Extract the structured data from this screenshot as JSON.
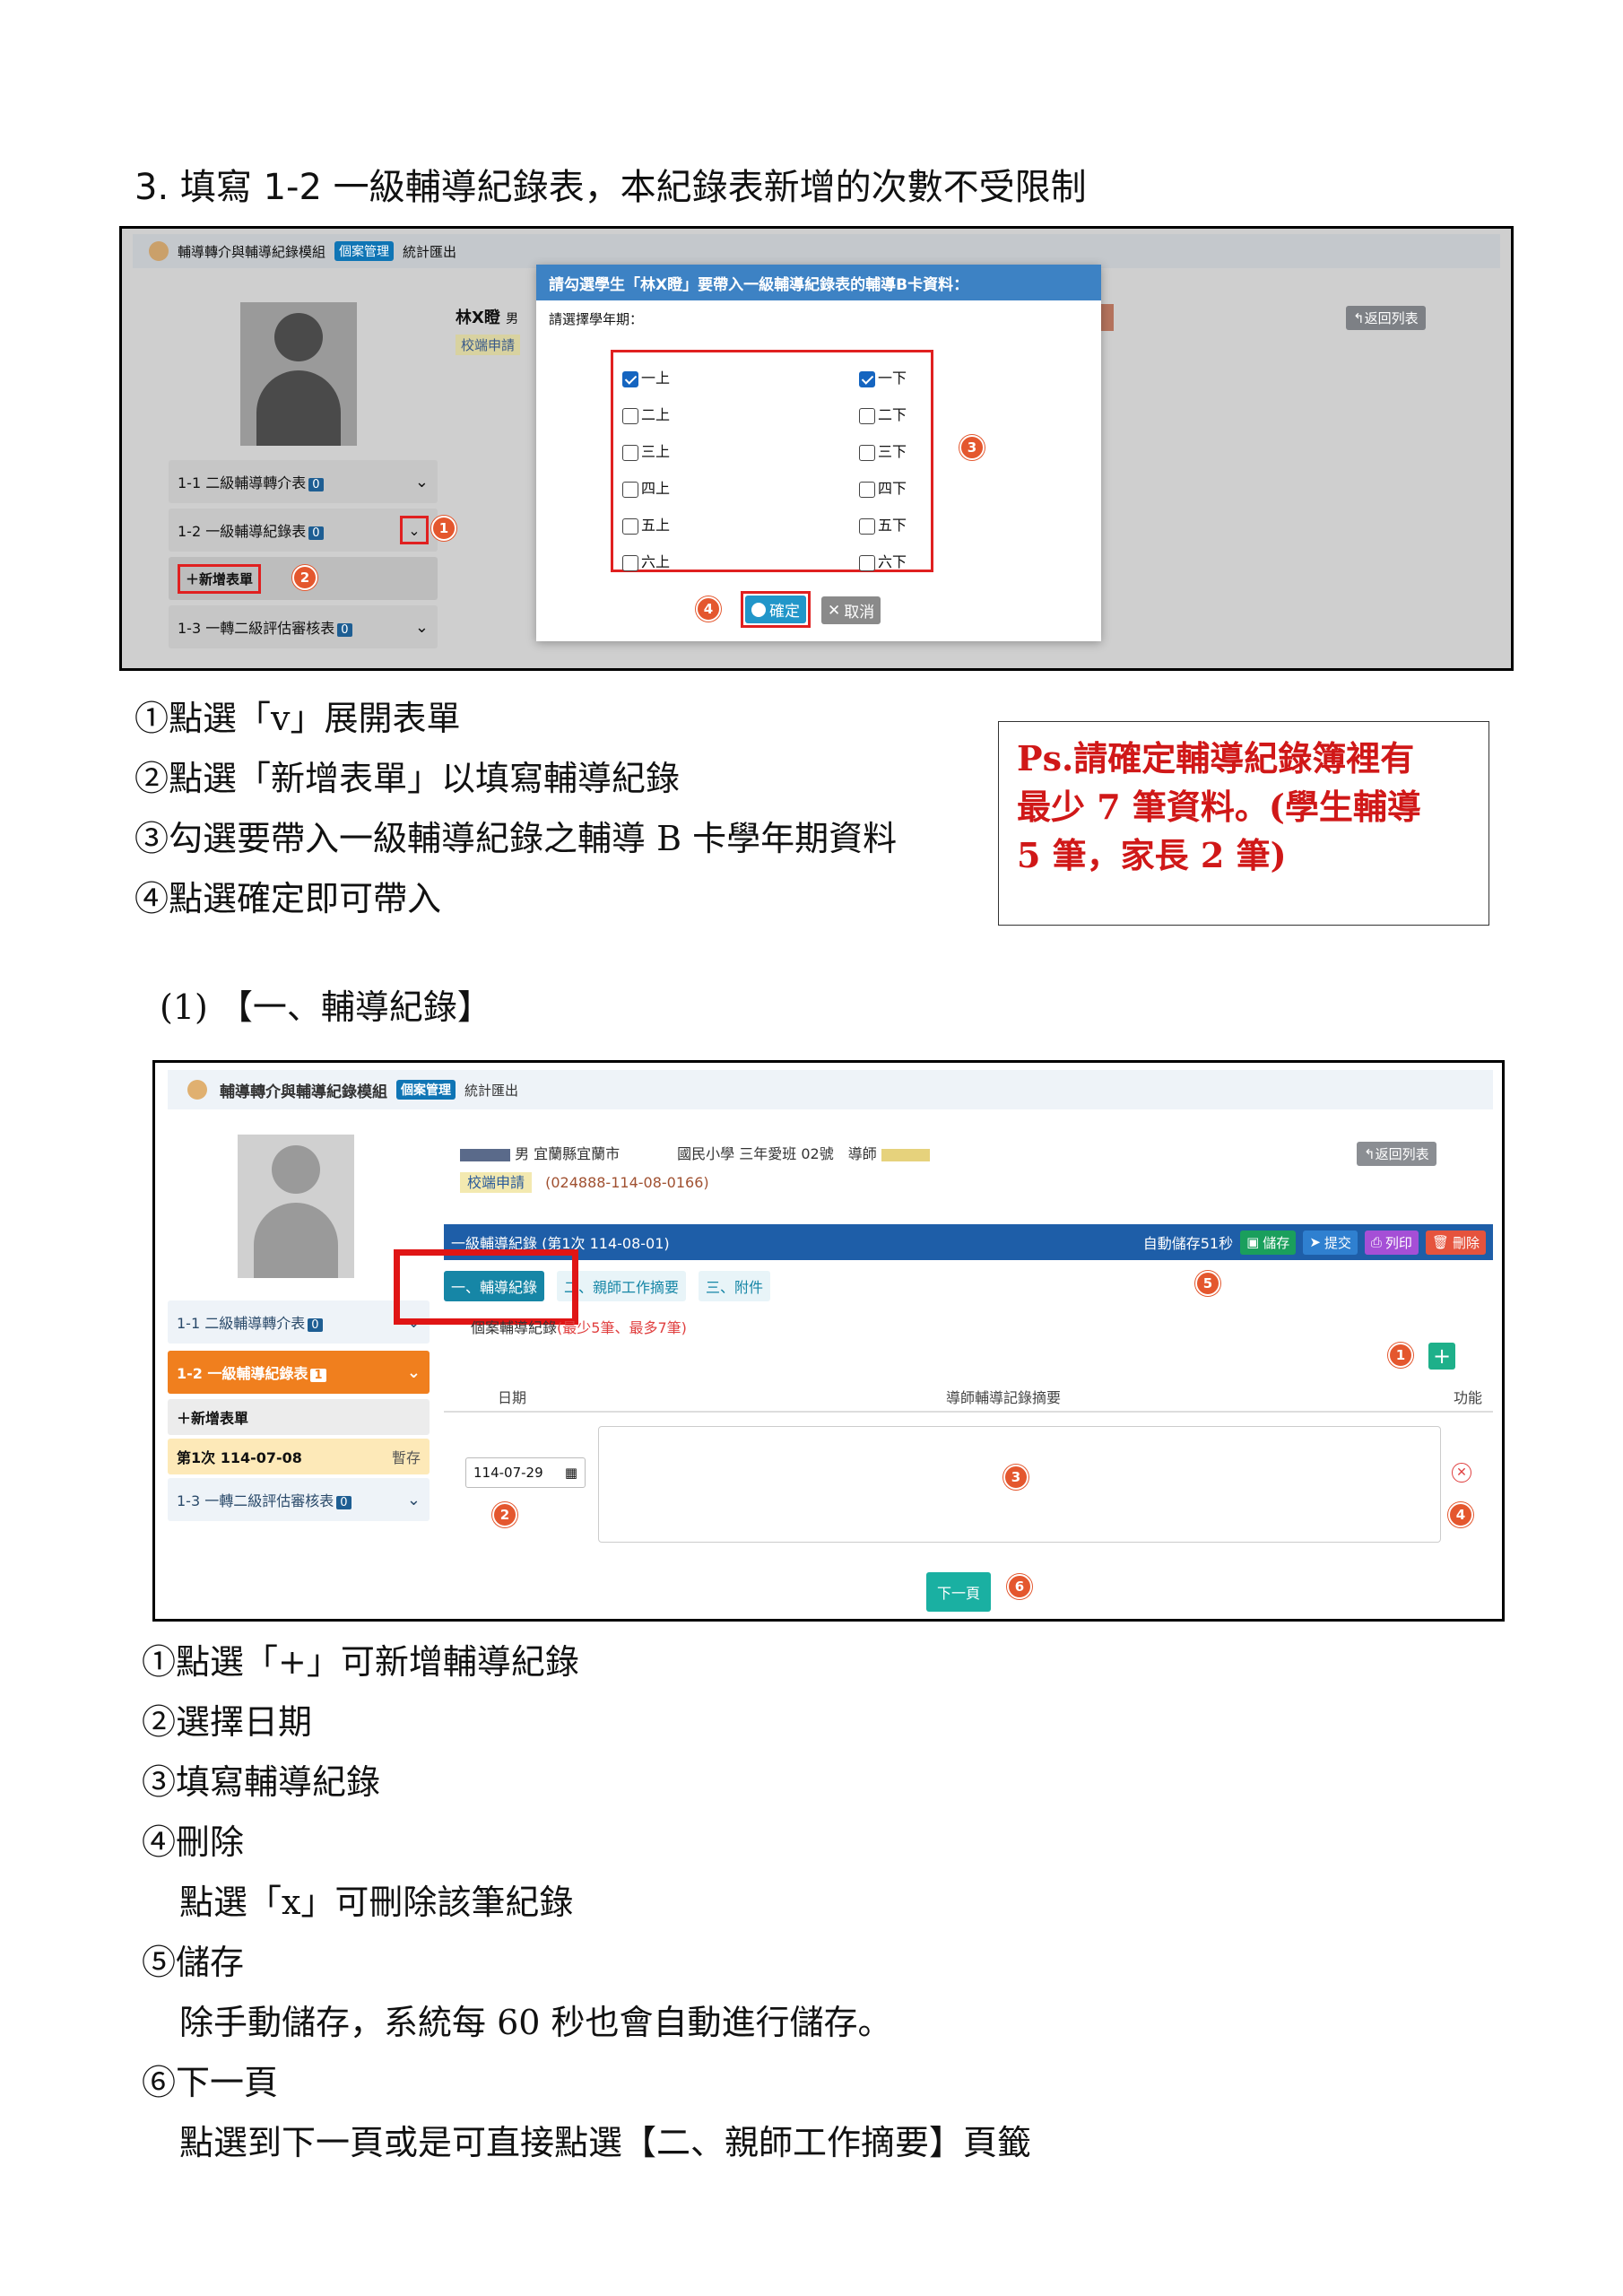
{
  "heading": "3.  填寫 1-2 一級輔導紀錄表，本紀錄表新增的次數不受限制",
  "shot1": {
    "app_title": "輔導轉介與輔導紀錄模組",
    "tab_case": "個案管理",
    "tab_stats": "統計匯出",
    "student_name": "林X瞪",
    "student_gender": "男",
    "status_tag": "校端申請",
    "back_btn": "返回列表",
    "side": [
      {
        "label": "1-1 二級輔導轉介表",
        "count": "0"
      },
      {
        "label": "1-2 一級輔導紀錄表",
        "count": "0"
      },
      {
        "label": "1-3 一轉二級評估審核表",
        "count": "0"
      }
    ],
    "add_form": "新增表單",
    "modal_title": "請勾選學生「林X瞪」要帶入一級輔導紀錄表的輔導B卡資料：",
    "modal_sub": "請選擇學年期：",
    "terms_left": [
      {
        "label": "一上",
        "checked": true
      },
      {
        "label": "二上",
        "checked": false
      },
      {
        "label": "三上",
        "checked": false
      },
      {
        "label": "四上",
        "checked": false
      },
      {
        "label": "五上",
        "checked": false
      },
      {
        "label": "六上",
        "checked": false
      }
    ],
    "terms_right": [
      {
        "label": "一下",
        "checked": true
      },
      {
        "label": "二下",
        "checked": false
      },
      {
        "label": "三下",
        "checked": false
      },
      {
        "label": "四下",
        "checked": false
      },
      {
        "label": "五下",
        "checked": false
      },
      {
        "label": "六下",
        "checked": false
      }
    ],
    "confirm": "確定",
    "cancel": "取消",
    "markers": [
      "1",
      "2",
      "3",
      "4"
    ]
  },
  "steps1": [
    "①點選「v」展開表單",
    "②點選「新增表單」以填寫輔導紀錄",
    "③勾選要帶入一級輔導紀錄之輔導 B 卡學年期資料",
    "④點選確定即可帶入"
  ],
  "note": {
    "line1": "Ps.請確定輔導紀錄簿裡有",
    "line2": "最少 7 筆資料。(學生輔導",
    "line3": "5 筆，家長 2 筆)"
  },
  "section_title": "(1) 【一、輔導紀錄】",
  "shot2": {
    "app_title": "輔導轉介與輔導紀錄模組",
    "tab_case": "個案管理",
    "tab_stats": "統計匯出",
    "student_line": "男 宜蘭縣宜蘭市　　　　國民小學 三年愛班 02號　導師",
    "status_tag": "校端申請",
    "case_no": "(024888-114-08-0166)",
    "back_btn": "返回列表",
    "form_bar": "一級輔導紀錄 (第1次 114-08-01)",
    "autosave": "自動儲存51秒",
    "btn_save": "儲存",
    "btn_submit": "提交",
    "btn_print": "列印",
    "btn_delete": "刪除",
    "tabs": [
      "一、輔導紀錄",
      "二、親師工作摘要",
      "三、附件"
    ],
    "record_title": "個案輔導紀錄",
    "record_hint": "(最少5筆、最多7筆)",
    "col_date": "日期",
    "col_summary": "導師輔導記錄摘要",
    "col_func": "功能",
    "date_value": "114-07-29",
    "side": [
      {
        "label": "1-1 二級輔導轉介表",
        "count": "0"
      },
      {
        "label": "1-2 一級輔導紀錄表",
        "count": "1"
      },
      {
        "label": "1-3 一轉二級評估審核表",
        "count": "0"
      }
    ],
    "add_form": "新增表單",
    "entry_label": "第1次 114-07-08",
    "entry_state": "暫存",
    "next_btn": "下一頁",
    "markers": [
      "1",
      "2",
      "3",
      "4",
      "5",
      "6"
    ]
  },
  "steps2": [
    "①點選「+」可新增輔導紀錄",
    "②選擇日期",
    "③填寫輔導紀錄",
    "④刪除",
    "點選「x」可刪除該筆紀錄",
    "⑤儲存",
    "除手動儲存，系統每 60 秒也會自動進行儲存。",
    "⑥下一頁",
    "點選到下一頁或是可直接點選【二、親師工作摘要】頁籤"
  ]
}
